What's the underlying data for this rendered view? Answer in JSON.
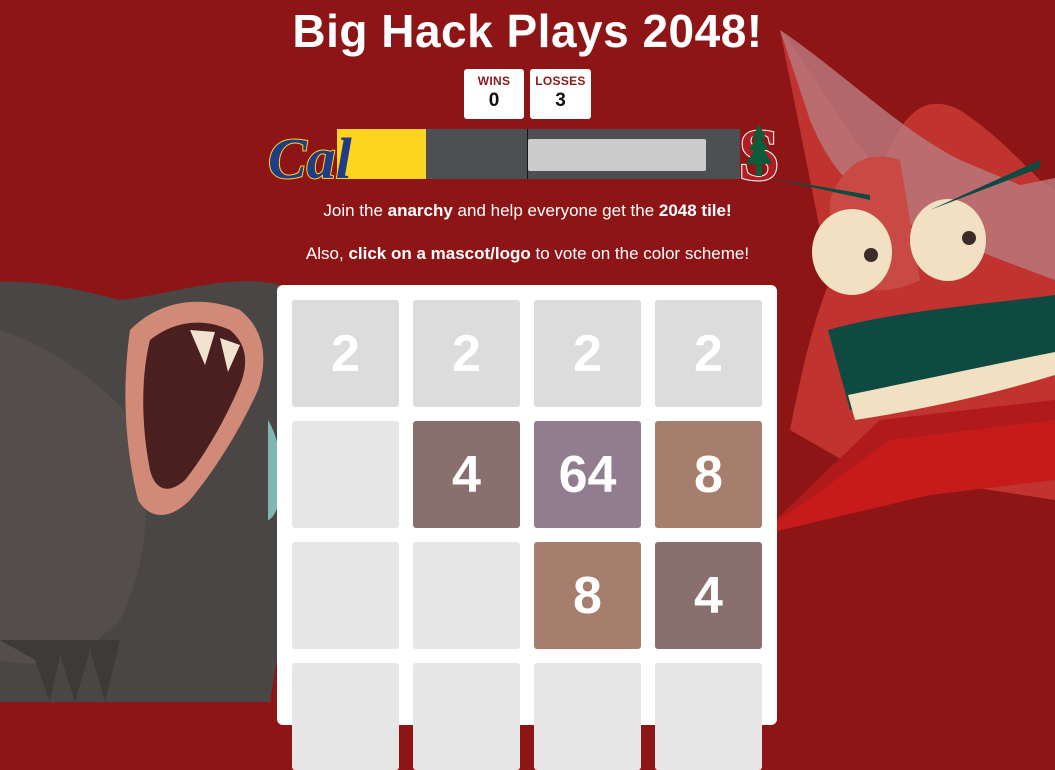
{
  "title": "Big Hack Plays 2048!",
  "scores": {
    "wins_label": "WINS",
    "wins_value": "0",
    "losses_label": "LOSSES",
    "losses_value": "3"
  },
  "vote": {
    "cal_fraction": 0.22,
    "left_team": "Cal",
    "right_team": "S",
    "input_value": ""
  },
  "info": {
    "line1_pre": "Join the ",
    "line1_bold1": "anarchy",
    "line1_mid": " and help everyone get the ",
    "line1_bold2": "2048 tile!",
    "line2_pre": "Also, ",
    "line2_bold": "click on a mascot/logo",
    "line2_post": " to vote on the color scheme!"
  },
  "board": {
    "rows": [
      [
        "2",
        "2",
        "2",
        "2"
      ],
      [
        "",
        "4",
        "64",
        "8"
      ],
      [
        "",
        "",
        "8",
        "4"
      ],
      [
        "",
        "",
        "",
        ""
      ]
    ]
  },
  "colors": {
    "background": "#8e1516",
    "cal_gold": "#fdd41f",
    "cal_blue": "#1f3c86",
    "tile_empty": "#e6e6e6",
    "tile_2": "#dcdcdc",
    "tile_4": "#8a6f6f",
    "tile_8": "#a67e6d",
    "tile_64": "#927c8f"
  }
}
